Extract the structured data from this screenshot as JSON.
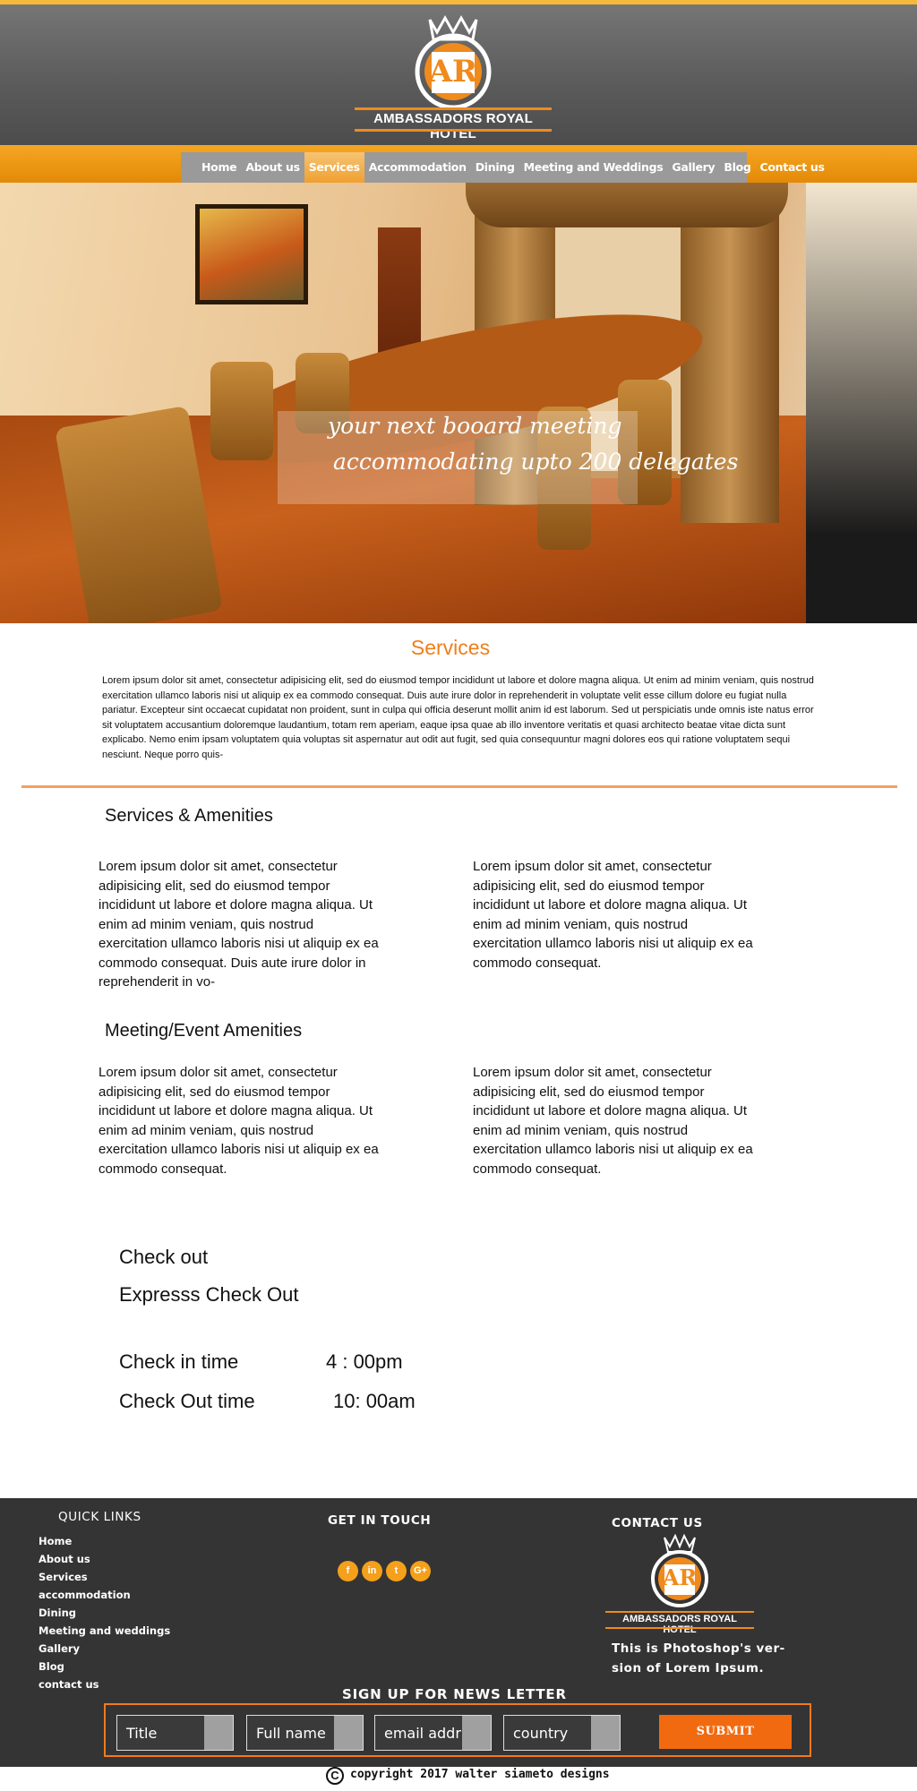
{
  "header": {
    "brand": "AMBASSADORS ROYAL HOTEL",
    "logo_monogram": "AR"
  },
  "nav": {
    "items": [
      "Home",
      "About us",
      "Services",
      "Accommodation",
      "Dining",
      "Meeting and Weddings",
      "Gallery",
      "Blog",
      "Contact us"
    ],
    "active": "Services"
  },
  "hero": {
    "caption_line1": "your next booard meeting",
    "caption_line2": "accommodating upto 200 delegates"
  },
  "services": {
    "title": "Services",
    "intro": "Lorem ipsum dolor sit amet, consectetur adipisicing elit, sed do eiusmod tempor incididunt ut labore et dolore magna aliqua. Ut enim ad minim veniam, quis nostrud exercitation ullamco laboris nisi ut aliquip ex ea commodo consequat. Duis aute irure dolor in reprehenderit in voluptate velit esse cillum dolore eu fugiat nulla pariatur. Excepteur sint occaecat cupidatat non proident, sunt in culpa qui officia deserunt mollit anim id est laborum. Sed ut perspiciatis unde omnis iste natus error sit voluptatem accusantium doloremque laudantium, totam rem aperiam, eaque ipsa quae ab illo inventore veritatis et quasi architecto beatae vitae dicta sunt explicabo. Nemo enim ipsam voluptatem quia voluptas sit aspernatur aut odit aut fugit, sed quia consequuntur magni dolores eos qui ratione voluptatem sequi nesciunt. Neque porro quis-"
  },
  "amenities": {
    "heading": "Services & Amenities",
    "col1": "Lorem ipsum dolor sit amet, consectetur adipisicing elit, sed do eiusmod tempor incididunt ut labore et dolore magna aliqua. Ut enim ad minim veniam, quis nostrud exercitation ullamco laboris nisi ut aliquip ex ea commodo consequat. Duis aute irure dolor in reprehenderit in vo-",
    "col2": "Lorem ipsum dolor sit amet, consectetur adipisicing elit, sed do eiusmod tempor incididunt ut labore et dolore magna aliqua. Ut enim ad minim veniam, quis nostrud exercitation ullamco laboris nisi ut aliquip ex ea commodo consequat."
  },
  "meeting": {
    "heading": "Meeting/Event Amenities",
    "col1": "Lorem ipsum dolor sit amet, consectetur adipisicing elit, sed do eiusmod tempor incididunt ut labore et dolore magna aliqua. Ut enim ad minim veniam, quis nostrud exercitation ullamco laboris nisi ut aliquip ex ea commodo consequat.",
    "col2": "Lorem ipsum dolor sit amet, consectetur adipisicing elit, sed do eiusmod tempor incididunt ut labore et dolore magna aliqua. Ut enim ad minim veniam, quis nostrud exercitation ullamco laboris nisi ut aliquip ex ea commodo consequat."
  },
  "checkout": {
    "title": "Check out",
    "express": "Expresss Check Out",
    "checkin_label": "Check in time",
    "checkin_time": "4 : 00pm",
    "checkout_label": "Check Out  time",
    "checkout_time": "10: 00am"
  },
  "footer": {
    "quick_links_heading": "QUICK LINKS",
    "quick_links": [
      "Home",
      "About us",
      "Services",
      "accommodation",
      "Dining",
      "Meeting and weddings",
      "Gallery",
      "Blog",
      "contact us"
    ],
    "get_in_touch": "GET IN TOUCH",
    "social": [
      {
        "icon": "facebook-icon",
        "glyph": "f"
      },
      {
        "icon": "linkedin-icon",
        "glyph": "in"
      },
      {
        "icon": "twitter-icon",
        "glyph": "t"
      },
      {
        "icon": "google-plus-icon",
        "glyph": "G+"
      }
    ],
    "contact_heading": "CONTACT US",
    "logo_text": "AMBASSADORS ROYAL HOTEL",
    "logo_monogram": "AR",
    "description": "This is Photoshop's ver- sion  of Lorem Ipsum.",
    "newsletter_heading": "SIGN UP FOR NEWS LETTER",
    "fields": [
      "Title",
      "Full name",
      "email addr",
      "country"
    ],
    "submit": "SUBMIT",
    "copyright_symbol": "C",
    "copyright": "copyright 2017  walter siameto designs"
  },
  "colors": {
    "accent": "#f07e1a",
    "nav_bar": "#f5a623",
    "footer_bg": "#343434",
    "submit": "#f26a10"
  }
}
